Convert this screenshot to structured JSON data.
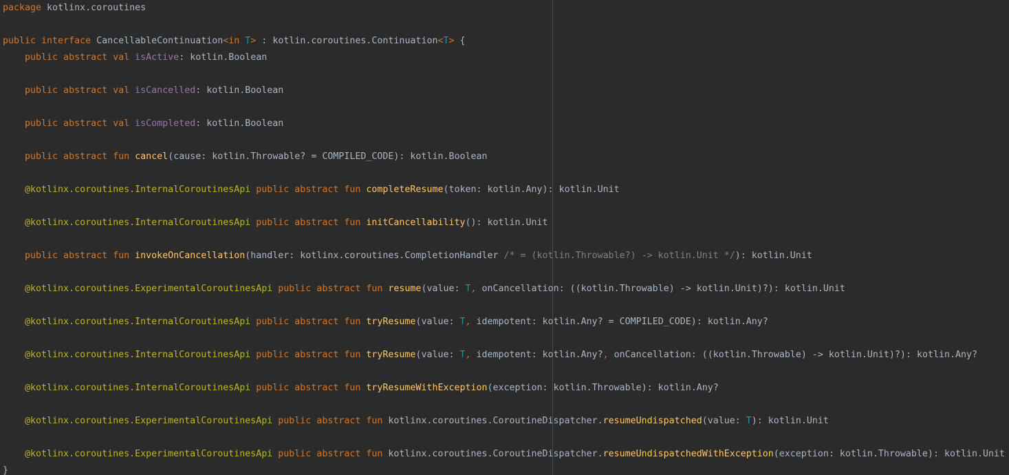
{
  "editor": {
    "language": "kotlin",
    "colors": {
      "background": "#2b2b2b",
      "keyword": "#cc7832",
      "type_param": "#20999d",
      "property": "#9876aa",
      "function": "#ffc66d",
      "annotation": "#bbb529",
      "comment": "#808080",
      "text": "#a9b7c6"
    },
    "lines": [
      [
        {
          "c": "kw",
          "t": "package"
        },
        {
          "c": "tx",
          "t": " kotlinx.coroutines"
        }
      ],
      [],
      [
        {
          "c": "kw",
          "t": "public interface"
        },
        {
          "c": "tx",
          "t": " CancellableContinuation"
        },
        {
          "c": "kw",
          "t": "<in "
        },
        {
          "c": "tp",
          "t": "T"
        },
        {
          "c": "kw",
          "t": ">"
        },
        {
          "c": "tx",
          "t": " : kotlin.coroutines.Continuation"
        },
        {
          "c": "kw",
          "t": "<"
        },
        {
          "c": "tp",
          "t": "T"
        },
        {
          "c": "kw",
          "t": ">"
        },
        {
          "c": "tx",
          "t": " {"
        }
      ],
      [
        {
          "c": "kw",
          "t": "    public abstract val "
        },
        {
          "c": "prop",
          "t": "isActive"
        },
        {
          "c": "tx",
          "t": ": kotlin.Boolean"
        }
      ],
      [],
      [
        {
          "c": "kw",
          "t": "    public abstract val "
        },
        {
          "c": "prop",
          "t": "isCancelled"
        },
        {
          "c": "tx",
          "t": ": kotlin.Boolean"
        }
      ],
      [],
      [
        {
          "c": "kw",
          "t": "    public abstract val "
        },
        {
          "c": "prop",
          "t": "isCompleted"
        },
        {
          "c": "tx",
          "t": ": kotlin.Boolean"
        }
      ],
      [],
      [
        {
          "c": "kw",
          "t": "    public abstract fun "
        },
        {
          "c": "fn",
          "t": "cancel"
        },
        {
          "c": "tx",
          "t": "(cause: kotlin.Throwable? = COMPILED_CODE): kotlin.Boolean"
        }
      ],
      [],
      [
        {
          "c": "ann",
          "t": "    @kotlinx.coroutines.InternalCoroutinesApi"
        },
        {
          "c": "kw",
          "t": " public abstract fun "
        },
        {
          "c": "fn",
          "t": "completeResume"
        },
        {
          "c": "tx",
          "t": "(token: kotlin.Any): kotlin.Unit"
        }
      ],
      [],
      [
        {
          "c": "ann",
          "t": "    @kotlinx.coroutines.InternalCoroutinesApi"
        },
        {
          "c": "kw",
          "t": " public abstract fun "
        },
        {
          "c": "fn",
          "t": "initCancellability"
        },
        {
          "c": "tx",
          "t": "(): kotlin.Unit"
        }
      ],
      [],
      [
        {
          "c": "kw",
          "t": "    public abstract fun "
        },
        {
          "c": "fn",
          "t": "invokeOnCancellation"
        },
        {
          "c": "tx",
          "t": "(handler: kotlinx.coroutines.CompletionHandler "
        },
        {
          "c": "cm",
          "t": "/* = (kotlin.Throwable?) -> kotlin.Unit */"
        },
        {
          "c": "tx",
          "t": "): kotlin.Unit"
        }
      ],
      [],
      [
        {
          "c": "ann",
          "t": "    @kotlinx.coroutines.ExperimentalCoroutinesApi"
        },
        {
          "c": "kw",
          "t": " public abstract fun "
        },
        {
          "c": "fn",
          "t": "resume"
        },
        {
          "c": "tx",
          "t": "(value: "
        },
        {
          "c": "tp",
          "t": "T"
        },
        {
          "c": "kw",
          "t": ", "
        },
        {
          "c": "tx",
          "t": "onCancellation: ((kotlin.Throwable) -> kotlin.Unit)?): kotlin.Unit"
        }
      ],
      [],
      [
        {
          "c": "ann",
          "t": "    @kotlinx.coroutines.InternalCoroutinesApi"
        },
        {
          "c": "kw",
          "t": " public abstract fun "
        },
        {
          "c": "fn",
          "t": "tryResume"
        },
        {
          "c": "tx",
          "t": "(value: "
        },
        {
          "c": "tp",
          "t": "T"
        },
        {
          "c": "kw",
          "t": ", "
        },
        {
          "c": "tx",
          "t": "idempotent: kotlin.Any? = COMPILED_CODE): kotlin.Any?"
        }
      ],
      [],
      [
        {
          "c": "ann",
          "t": "    @kotlinx.coroutines.InternalCoroutinesApi"
        },
        {
          "c": "kw",
          "t": " public abstract fun "
        },
        {
          "c": "fn",
          "t": "tryResume"
        },
        {
          "c": "tx",
          "t": "(value: "
        },
        {
          "c": "tp",
          "t": "T"
        },
        {
          "c": "kw",
          "t": ", "
        },
        {
          "c": "tx",
          "t": "idempotent: kotlin.Any?"
        },
        {
          "c": "kw",
          "t": ", "
        },
        {
          "c": "tx",
          "t": "onCancellation: ((kotlin.Throwable) -> kotlin.Unit)?): kotlin.Any?"
        }
      ],
      [],
      [
        {
          "c": "ann",
          "t": "    @kotlinx.coroutines.InternalCoroutinesApi"
        },
        {
          "c": "kw",
          "t": " public abstract fun "
        },
        {
          "c": "fn",
          "t": "tryResumeWithException"
        },
        {
          "c": "tx",
          "t": "(exception: kotlin.Throwable): kotlin.Any?"
        }
      ],
      [],
      [
        {
          "c": "ann",
          "t": "    @kotlinx.coroutines.ExperimentalCoroutinesApi"
        },
        {
          "c": "kw",
          "t": " public abstract fun "
        },
        {
          "c": "tx",
          "t": "kotlinx.coroutines.CoroutineDispatcher."
        },
        {
          "c": "fn",
          "t": "resumeUndispatched"
        },
        {
          "c": "tx",
          "t": "(value: "
        },
        {
          "c": "tp",
          "t": "T"
        },
        {
          "c": "tx",
          "t": "): kotlin.Unit"
        }
      ],
      [],
      [
        {
          "c": "ann",
          "t": "    @kotlinx.coroutines.ExperimentalCoroutinesApi"
        },
        {
          "c": "kw",
          "t": " public abstract fun "
        },
        {
          "c": "tx",
          "t": "kotlinx.coroutines.CoroutineDispatcher."
        },
        {
          "c": "fn",
          "t": "resumeUndispatchedWithException"
        },
        {
          "c": "tx",
          "t": "(exception: kotlin.Throwable): kotlin.Unit"
        }
      ],
      [
        {
          "c": "tx",
          "t": "}"
        }
      ]
    ]
  }
}
